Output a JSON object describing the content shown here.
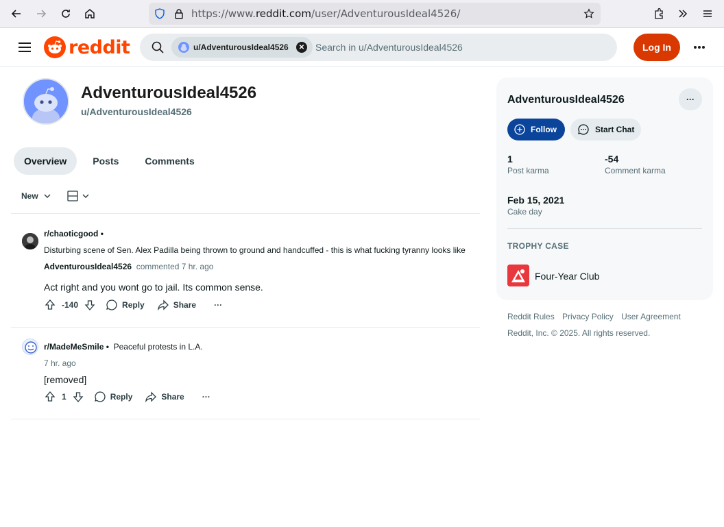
{
  "browser": {
    "url_prefix": "https://www.",
    "url_host": "reddit.com",
    "url_path": "/user/AdventurousIdeal4526/"
  },
  "header": {
    "logo_text": "reddit",
    "search_chip": "u/AdventurousIdeal4526",
    "search_placeholder": "Search in u/AdventurousIdeal4526",
    "login_label": "Log In"
  },
  "profile": {
    "display_name": "AdventurousIdeal4526",
    "handle": "u/AdventurousIdeal4526",
    "tabs": [
      {
        "label": "Overview",
        "active": true
      },
      {
        "label": "Posts",
        "active": false
      },
      {
        "label": "Comments",
        "active": false
      }
    ],
    "sort_label": "New"
  },
  "feed": [
    {
      "subreddit": "r/chaoticgood",
      "separator": "•",
      "post_title": "Disturbing scene of Sen. Alex Padilla being thrown to ground and handcuffed - this is what fucking tyranny looks like",
      "author": "AdventurousIdeal4526",
      "meta_text": "commented 7 hr. ago",
      "body": "Act right and you wont go to jail. Its common sense.",
      "score": "-140",
      "reply_label": "Reply",
      "share_label": "Share",
      "more_label": "···"
    },
    {
      "subreddit": "r/MadeMeSmile",
      "separator": "•",
      "post_title": "Peaceful protests in L.A.",
      "meta_text": "7 hr. ago",
      "body": "[removed]",
      "score": "1",
      "reply_label": "Reply",
      "share_label": "Share",
      "more_label": "···"
    }
  ],
  "sidebar": {
    "name": "AdventurousIdeal4526",
    "more_label": "···",
    "follow_label": "Follow",
    "chat_label": "Start Chat",
    "post_karma": "1",
    "post_karma_label": "Post karma",
    "comment_karma": "-54",
    "comment_karma_label": "Comment karma",
    "cake_day": "Feb 15, 2021",
    "cake_day_label": "Cake day",
    "trophy_heading": "TROPHY CASE",
    "trophies": [
      {
        "name": "Four-Year Club"
      }
    ]
  },
  "footer": {
    "links": [
      "Reddit Rules",
      "Privacy Policy",
      "User Agreement"
    ],
    "copyright": "Reddit, Inc. © 2025. All rights reserved."
  },
  "colors": {
    "brand": "#ff4500",
    "login": "#d93900",
    "follow": "#0a449b"
  }
}
